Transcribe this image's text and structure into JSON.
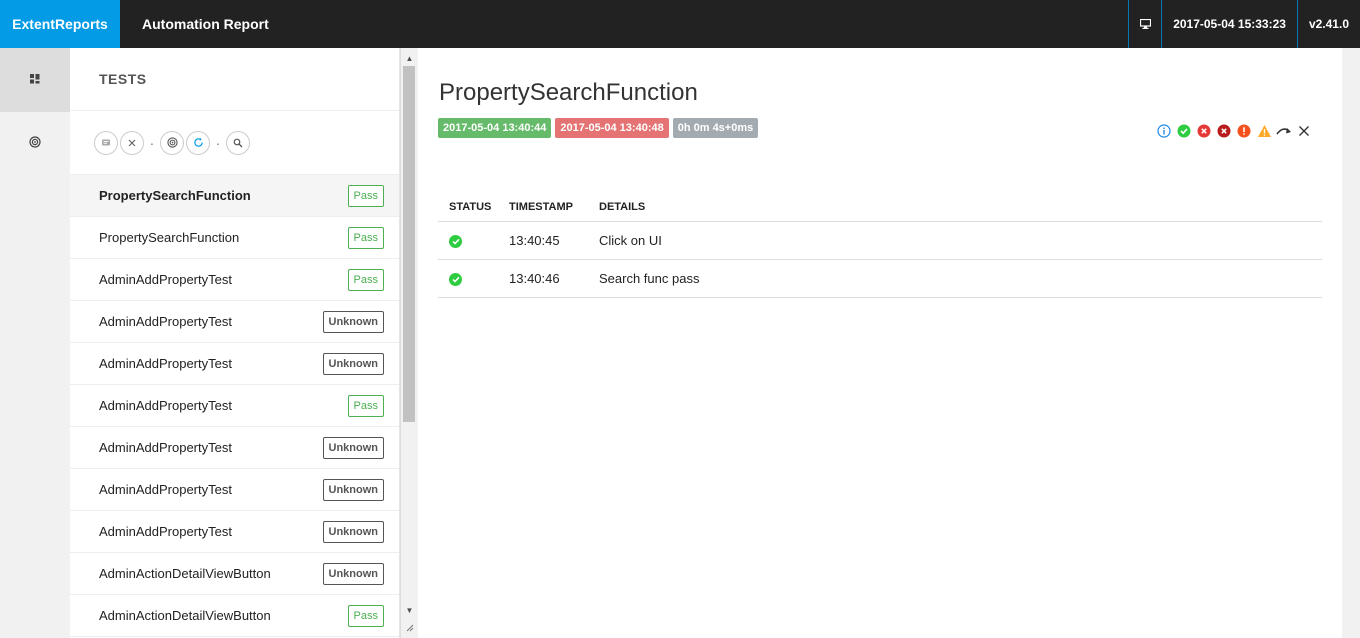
{
  "header": {
    "brand": "ExtentReports",
    "title": "Automation Report",
    "datetime": "2017-05-04 15:33:23",
    "version": "v2.41.0",
    "monitor_icon": "monitor-icon"
  },
  "leftnav": {
    "items": [
      {
        "icon": "dashboard-icon",
        "active": true
      },
      {
        "icon": "category-icon",
        "active": false
      }
    ]
  },
  "tests": {
    "heading": "TESTS",
    "filters": [
      "comment-icon",
      "close-icon",
      "dot",
      "category-icon",
      "refresh-icon",
      "dot",
      "search-icon"
    ],
    "items": [
      {
        "name": "PropertySearchFunction",
        "status": "Pass",
        "active": true
      },
      {
        "name": "PropertySearchFunction",
        "status": "Pass"
      },
      {
        "name": "AdminAddPropertyTest",
        "status": "Pass"
      },
      {
        "name": "AdminAddPropertyTest",
        "status": "Unknown"
      },
      {
        "name": "AdminAddPropertyTest",
        "status": "Unknown"
      },
      {
        "name": "AdminAddPropertyTest",
        "status": "Pass"
      },
      {
        "name": "AdminAddPropertyTest",
        "status": "Unknown"
      },
      {
        "name": "AdminAddPropertyTest",
        "status": "Unknown"
      },
      {
        "name": "AdminAddPropertyTest",
        "status": "Unknown"
      },
      {
        "name": "AdminActionDetailViewButton",
        "status": "Unknown"
      },
      {
        "name": "AdminActionDetailViewButton",
        "status": "Pass"
      }
    ]
  },
  "detail": {
    "name": "PropertySearchFunction",
    "start": "2017-05-04 13:40:44",
    "end": "2017-05-04 13:40:48",
    "duration": "0h 0m 4s+0ms",
    "status_filters": [
      "info-icon",
      "pass-icon",
      "fail-icon",
      "fatal-icon",
      "error-icon",
      "warning-icon",
      "skip-icon",
      "clear-icon"
    ],
    "columns": {
      "status": "STATUS",
      "timestamp": "TIMESTAMP",
      "details": "DETAILS"
    },
    "logs": [
      {
        "status": "pass",
        "timestamp": "13:40:45",
        "details": "Click on UI"
      },
      {
        "status": "pass",
        "timestamp": "13:40:46",
        "details": "Search func pass"
      }
    ]
  },
  "colors": {
    "brand": "#039be5",
    "topbar": "#222222",
    "pass": "#4caf50",
    "start_badge": "#66bb6a",
    "end_badge": "#e57373",
    "duration_badge": "#a3aab0"
  }
}
